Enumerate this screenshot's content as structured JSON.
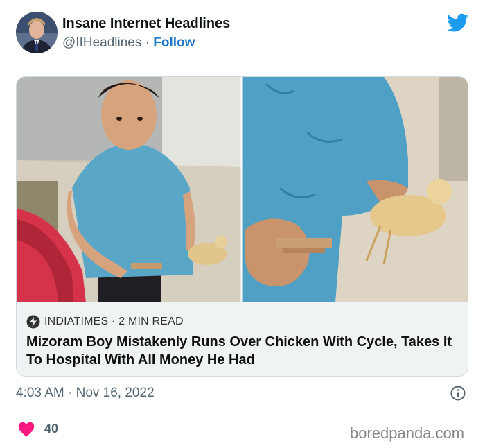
{
  "author": {
    "name": "Insane Internet Headlines",
    "handle": "@IIHeadlines",
    "separator": "·",
    "follow_label": "Follow",
    "avatar_icon": "avatar-man-in-suit"
  },
  "brand": {
    "icon": "twitter-bird-icon",
    "color": "#1d9bf0"
  },
  "card": {
    "image_description_icon": "photo-boy-holding-chicken-and-money",
    "source": "INDIATIMES",
    "read_time": "2 MIN READ",
    "headline": "Mizoram Boy Mistakenly Runs Over Chicken With Cycle, Takes It To Hospital With All Money He Had"
  },
  "meta": {
    "time": "4:03 AM",
    "date": "Nov 16, 2022"
  },
  "engagement": {
    "likes": "40",
    "heart_color": "#f91880"
  },
  "watermark": "boredpanda.com"
}
